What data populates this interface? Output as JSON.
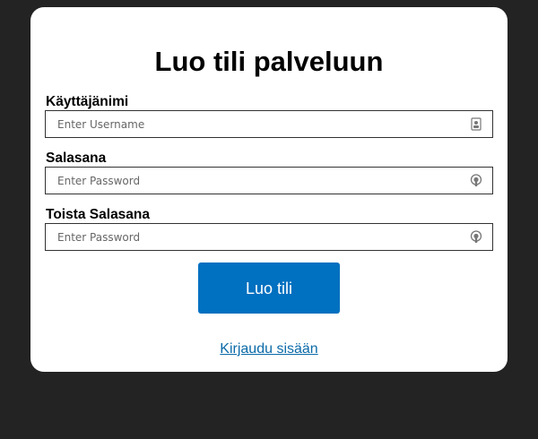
{
  "form": {
    "title": "Luo tili palveluun",
    "fields": [
      {
        "label": "Käyttäjänimi",
        "placeholder": "Enter Username",
        "value": "",
        "icon": "user-badge-icon"
      },
      {
        "label": "Salasana",
        "placeholder": "Enter Password",
        "value": "",
        "icon": "lock-icon"
      },
      {
        "label": "Toista Salasana",
        "placeholder": "Enter Password",
        "value": "",
        "icon": "lock-icon"
      }
    ],
    "submit_label": "Luo tili",
    "login_link": "Kirjaudu sisään"
  },
  "colors": {
    "background": "#232323",
    "card": "#ffffff",
    "button": "#0070c0",
    "link": "#0b6aa8"
  }
}
